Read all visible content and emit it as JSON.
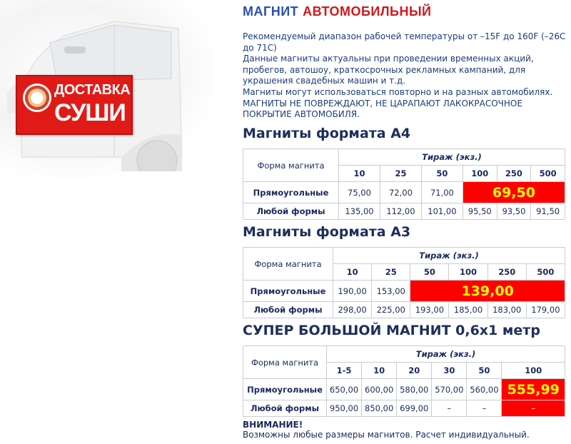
{
  "banner": {
    "line1": "ДОСТАВКА",
    "line2": "СУШИ"
  },
  "brand": {
    "word1": "МАГНИТ",
    "word2": "АВТОМОБИЛЬНЫЙ"
  },
  "intro": [
    "Рекомендуемый диапазон рабочей температуры от –15F до 160F (–26С до 71С)",
    "Данные магниты актуальны при проведении временных акций, пробегов, автошоу, краткосрочных рекламных кампаний, для украшения свадебных машин и т.д.",
    "Магниты могут использоваться повторно и на разных автомобилях.",
    "МАГНИТЫ НЕ ПОВРЕЖДАЮТ, НЕ ЦАРАПАЮТ ЛАКОКРАСОЧНОЕ ПОКРЫТИЕ АВТОМОБИЛЯ."
  ],
  "a4": {
    "title": "Магниты формата А4",
    "form_header": "Форма магнита",
    "tirazh": "Тираж (экз.)",
    "qty": [
      "10",
      "25",
      "50",
      "100",
      "250",
      "500"
    ],
    "rect_label": "Прямоугольные",
    "rect": [
      "75,00",
      "72,00",
      "71,00"
    ],
    "rect_hl": "69,50",
    "any_label": "Любой формы",
    "any": [
      "135,00",
      "112,00",
      "101,00",
      "95,50",
      "93,50",
      "91,50"
    ]
  },
  "a3": {
    "title": "Магниты формата А3",
    "form_header": "Форма магнита",
    "tirazh": "Тираж (экз.)",
    "qty": [
      "10",
      "25",
      "50",
      "100",
      "250",
      "500"
    ],
    "rect_label": "Прямоугольные",
    "rect": [
      "190,00",
      "153,00"
    ],
    "rect_hl": "139,00",
    "any_label": "Любой формы",
    "any": [
      "298,00",
      "225,00",
      "193,00",
      "185,00",
      "183,00",
      "179,00"
    ]
  },
  "big": {
    "title": "СУПЕР БОЛЬШОЙ МАГНИТ 0,6х1 метр",
    "form_header": "Форма магнита",
    "tirazh": "Тираж (экз.)",
    "qty": [
      "1-5",
      "10",
      "20",
      "30",
      "50",
      "100"
    ],
    "rect_label": "Прямоугольные",
    "rect": [
      "650,00",
      "600,00",
      "580,00",
      "570,00",
      "560,00"
    ],
    "rect_hl": "555,99",
    "any_label": "Любой формы",
    "any": [
      "950,00",
      "850,00",
      "699,00",
      "–",
      "–"
    ],
    "any_last": "–"
  },
  "warning": {
    "title": "ВНИМАНИЕ!",
    "text": "Возможны любые размеры магнитов. Расчет индивидуальный."
  }
}
